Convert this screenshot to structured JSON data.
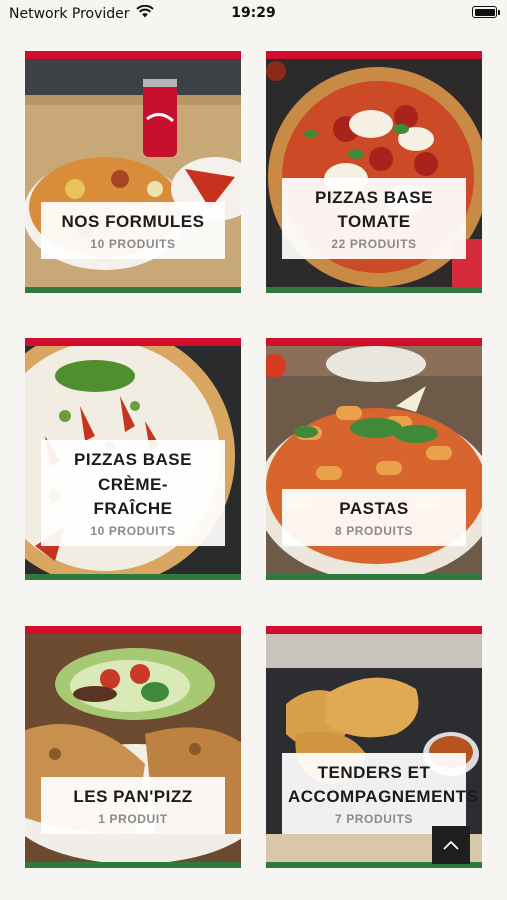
{
  "status_bar": {
    "carrier": "Network Provider",
    "time": "19:29",
    "wifi_icon": "wifi-icon",
    "battery_icon": "battery-icon"
  },
  "categories": [
    {
      "title": "NOS FORMULES",
      "count": "10 PRODUITS",
      "image": "pizza-with-cola-photo"
    },
    {
      "title": "PIZZAS BASE TOMATE",
      "count": "22 PRODUITS",
      "image": "tomato-pizza-photo"
    },
    {
      "title": "PIZZAS BASE CRÈME-FRAÎCHE",
      "title_line1": "PIZZAS BASE CRÈME-",
      "title_line2": "FRAÎCHE",
      "count": "10 PRODUITS",
      "image": "cream-pizza-photo"
    },
    {
      "title": "PASTAS",
      "count": "8 PRODUITS",
      "image": "pasta-photo"
    },
    {
      "title": "LES PAN'PIZZ",
      "count": "1 PRODUIT",
      "image": "panpizz-photo"
    },
    {
      "title": "TENDERS ET ACCOMPAGNEMENTS",
      "title_line1": "TENDERS ET",
      "title_line2": "ACCOMPAGNEMENTS",
      "count": "7 PRODUITS",
      "image": "tenders-photo"
    }
  ],
  "scroll_top_icon": "chevron-up-icon",
  "colors": {
    "top_border": "#d10d2c",
    "bottom_border": "#2f7a3c",
    "background": "#f6f5f2"
  }
}
